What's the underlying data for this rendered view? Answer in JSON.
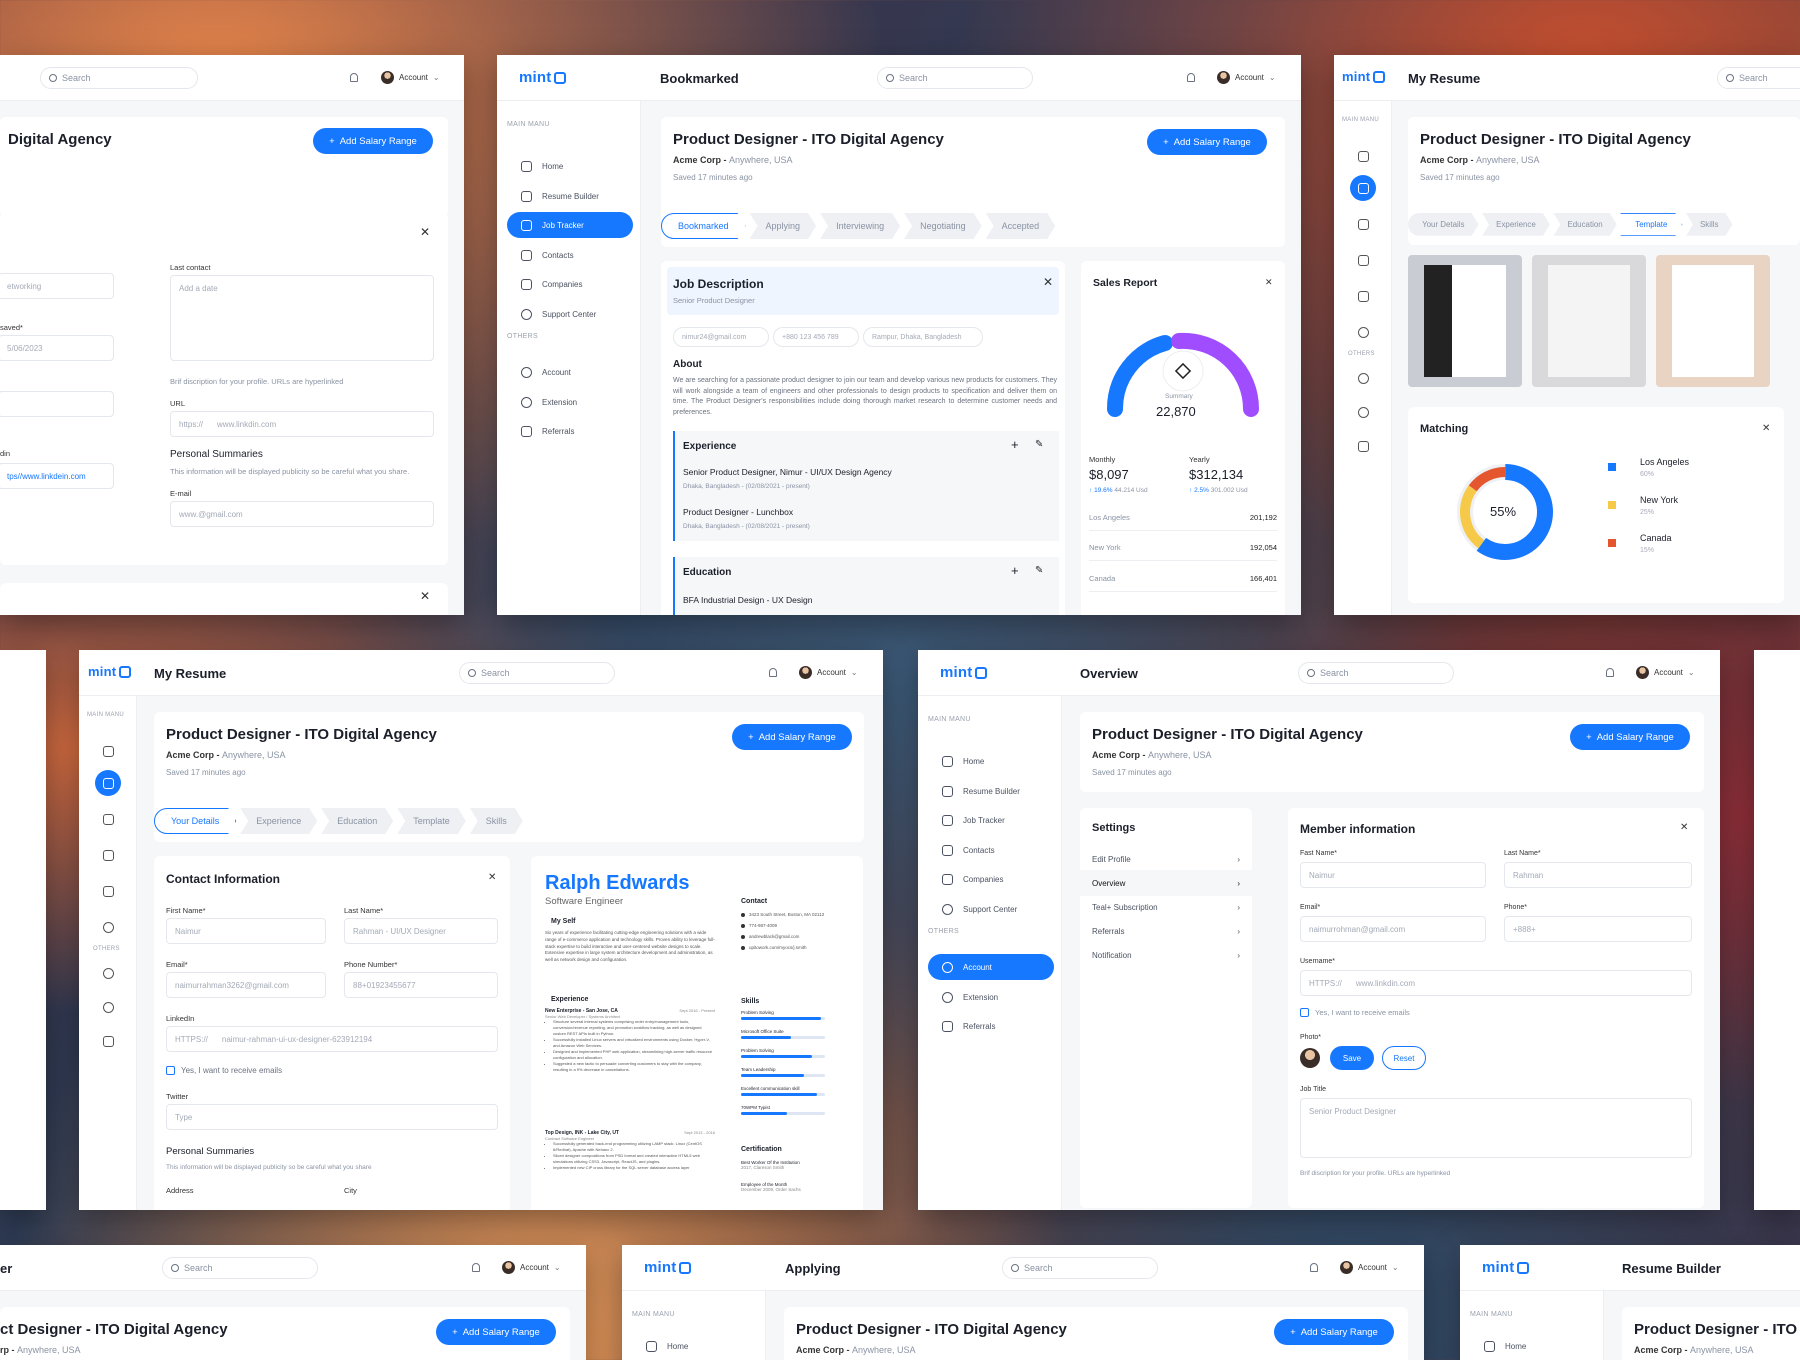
{
  "common": {
    "logo": "mint",
    "search_placeholder": "Search",
    "account": "Account",
    "main_menu": "MAIN MANU",
    "others": "OTHERS",
    "job_title": "Product Designer - ITO Digital Agency",
    "company": "Acme Corp",
    "location": "Anywhere, USA",
    "saved": "Saved 17 minutes ago",
    "add_salary": "Add Salary Range",
    "nav": [
      "Home",
      "Resume Builder",
      "Job Tracker",
      "Contacts",
      "Companies",
      "Support Center"
    ],
    "others_nav": [
      "Account",
      "Extension",
      "Referrals"
    ]
  },
  "s1": {
    "title_partial": "Digital Agency",
    "last_contact": "Last contact",
    "add_date": "Add a date",
    "networking": "etworking",
    "saved_label": "saved*",
    "date_value": "5/06/2023",
    "brief": "Brif discription for your profile. URLs are hyperlinked",
    "url_label": "URL",
    "url_prefix": "https://",
    "url_value": "www.linkdin.com",
    "personal": "Personal Summaries",
    "personal_desc": "This information will be displayed publicity so be careful what you share.",
    "email_label": "E-mail",
    "email_placeholder": "www.@gmail.com",
    "linkedin_partial": "din",
    "linkedin_value": "tps//www.linkdein.com"
  },
  "s2": {
    "page_title": "Bookmarked",
    "steps": [
      "Bookmarked",
      "Applying",
      "Interviewing",
      "Negotiating",
      "Accepted"
    ],
    "jd_title": "Job Description",
    "jd_sub": "Senior Product Designer",
    "contact_email": "nimur24@gmail.com",
    "contact_phone": "+880 123 456 789",
    "contact_loc": "Rampur, Dhaka, Bangladesh",
    "about": "About",
    "about_text": "We are searching for a passionate product designer to join our team and develop various new products for customers. They will work alongside a team of engineers and other professionals to design products to specification and deliver them on time. The Product Designer's responsibilities include doing thorough market research to determine customer needs and preferences.",
    "experience": "Experience",
    "exp1_title": "Senior Product Designer, Nimur - UI/UX Design Agency",
    "exp1_sub": "Dhaka, Bangladesh - (02/08/2021 - present)",
    "exp2_title": "Product Designer - Lunchbox",
    "exp2_sub": "Dhaka, Bangladesh - (02/08/2021 - present)",
    "education": "Education",
    "edu1": "BFA Industrial Design - UX Design",
    "sales_title": "Sales Report",
    "summary_label": "Summary",
    "summary_value": "22,870",
    "monthly_label": "Monthly",
    "monthly_value": "$8,097",
    "monthly_change": "19.6%",
    "monthly_sub": "44.214 Usd",
    "yearly_label": "Yearly",
    "yearly_value": "$312,134",
    "yearly_change": "2.5%",
    "yearly_sub": "301.002 Usd",
    "rows": [
      {
        "city": "Los Angeles",
        "value": "201,192"
      },
      {
        "city": "New York",
        "value": "192,054"
      },
      {
        "city": "Canada",
        "value": "166,401"
      }
    ]
  },
  "s3": {
    "page_title": "My Resume",
    "steps": [
      "Your Details",
      "Experience",
      "Education",
      "Template",
      "Skills"
    ],
    "matching": "Matching",
    "percent": "55%",
    "legend": [
      {
        "name": "Los Angeles",
        "pct": "60%",
        "color": "#1677ff"
      },
      {
        "name": "New York",
        "pct": "25%",
        "color": "#f7c948"
      },
      {
        "name": "Canada",
        "pct": "15%",
        "color": "#e4572e"
      }
    ]
  },
  "s4": {
    "page_title": "My Resume",
    "steps": [
      "Your Details",
      "Experience",
      "Education",
      "Template",
      "Skills"
    ],
    "contact_info": "Contact Information",
    "first_name": "First Name*",
    "first_val": "Naimur",
    "last_name": "Last Name*",
    "last_val": "Rahman - UI/UX Designer",
    "email": "Email*",
    "email_val": "naimurrahman3262@gmail.com",
    "phone": "Phone Number*",
    "phone_val": "88+01923455677",
    "linkedin": "LinkedIn",
    "https": "HTTPS://",
    "linkedin_val": "naimur-rahman-ui-ux-designer-623912194",
    "receive": "Yes, I want to receive emails",
    "twitter": "Twitter",
    "twitter_ph": "Type",
    "personal": "Personal Summaries",
    "personal_desc": "This information will be displayed publicity so be careful what you share",
    "address": "Address",
    "city": "City",
    "cv_name": "Ralph Edwards",
    "cv_role": "Software Engineer",
    "cv_myself": "My Self",
    "cv_myself_text": "Six years of experience facilitating cutting-edge engineering solutions with a wide range of e-commerce application and technology skills. Proven ability to leverage full-stack expertise to build interactive and user-centered website designs to scale. Extensive expertise in large system architecture development and administration, as well as network design and configuration.",
    "cv_experience": "Experience",
    "cv_job1": "New Enterprise - San Jose, CA",
    "cv_job1_sub": "Senior Web Developer / Systems Architect",
    "cv_job1_date": "Sept 2016 - Present",
    "cv_job1_bullets": [
      "Structure several internal systems comprising order entry/management tools, conversion/revenue reporting, and promotion workflow tracking, as well as designed custom REST APIs built in Python.",
      "Successfully installed Linux servers and virtualized environments using Docker, Hyper-V, and Amazon Web Services.",
      "Designed and implemented PHP web application, streamlining high-server traffic resource configuration and allocation.",
      "Suggested a new tactic to persuade converting customers to stay with the company, resulting in a 9% decrease in cancellations."
    ],
    "cv_job2": "Top Design, INK - Lake City, UT",
    "cv_job2_sub": "Contract Software Engineer",
    "cv_job2_date": "Sept 2013 - 2016",
    "cv_job2_bullets": [
      "Successfully generated back-end programming utilizing LAMP stack: Linux (CentOS 6/Redhat), Apache with Nehanc 2.",
      "Sliced designer compositions from PSD format and created interactive HTML5 web simulations utilizing CSS3, Javascript, ReactJS, and plugins.",
      "Implemented new CIP cross library for the SQL server database access layer"
    ],
    "cv_contact": "Contact",
    "cv_contacts": [
      "3423 South Street, Boston, MA 02112",
      "774-987-4009",
      "andrewblack@gmail.com",
      "upitowork.com/myocs/j.smith"
    ],
    "cv_skills": "Skills",
    "cv_skill_list": [
      {
        "name": "Problem Solving",
        "level": 0.95
      },
      {
        "name": "Microsoft Office Suite",
        "level": 0.6
      },
      {
        "name": "Problem Solving",
        "level": 0.85
      },
      {
        "name": "Team Leadership",
        "level": 0.75
      },
      {
        "name": "Excellent communication skill",
        "level": 0.9
      },
      {
        "name": "70WPM Typist",
        "level": 0.55
      }
    ],
    "cv_cert": "Certification",
    "cv_cert1": "Best Worker Of the Institution",
    "cv_cert1_sub": "2017, Clareson Smith",
    "cv_cert2": "Employee of the Month",
    "cv_cert2_sub": "December 2009, Order Sachs"
  },
  "s5": {
    "page_title": "Overview",
    "settings": "Settings",
    "settings_items": [
      "Edit Profile",
      "Overview",
      "Teal+ Subscription",
      "Referrals",
      "Notification"
    ],
    "member_info": "Member information",
    "fast_name": "Fast Name*",
    "fast_val": "Naimur",
    "last_name": "Last Name*",
    "last_val": "Rahman",
    "email": "Email*",
    "email_val": "naimurrohman@gmail.com",
    "phone": "Phone*",
    "phone_val": "+888+",
    "username": "Username*",
    "https": "HTTPS://",
    "username_val": "www.linkdin.com",
    "receive": "Yes, I want to receive emails",
    "photo": "Photo*",
    "save": "Save",
    "reset": "Reset",
    "job_title_label": "Job Title",
    "job_title_ph": "Senior Product Designer",
    "brief": "Brif discription for your profile. URLs are hyperlinked"
  },
  "s6": {
    "title_partial": "ct Designer - ITO Digital Agency",
    "company_partial": "rp",
    "er": "er"
  },
  "s7": {
    "page_title": "Applying",
    "home": "Home"
  },
  "s8": {
    "page_title": "Resume Builder",
    "title_partial": "Product Designer - ITO",
    "home": "Home"
  }
}
